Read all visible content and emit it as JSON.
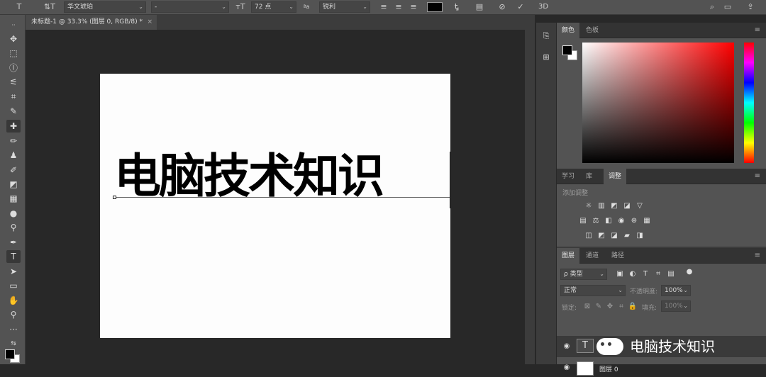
{
  "optbar": {
    "font_family": "华文琥珀",
    "font_style": "-",
    "font_size": "72 点",
    "aa_label": "ªa",
    "antialias": "锐利",
    "three_d": "3D"
  },
  "document": {
    "tab_title": "未标题-1 @ 33.3% (图层 0, RGB/8) *",
    "canvas_text": "电脑技术知识"
  },
  "color_panel": {
    "tabs": [
      "颜色",
      "色板"
    ],
    "foreground": "#000000",
    "background": "#ffffff",
    "hue_marker": "#ff0000"
  },
  "adjust_panel": {
    "tabs": [
      "学习",
      "库",
      "调整"
    ],
    "hint": "添加调整"
  },
  "layers_panel": {
    "tabs": [
      "图层",
      "通道",
      "路径"
    ],
    "kind_filter": "ρ 类型",
    "blend_mode": "正常",
    "opacity_label": "不透明度:",
    "opacity_value": "100%",
    "lock_label": "锁定:",
    "fill_label": "填充:",
    "fill_value": "100%",
    "layers": [
      {
        "name": "电脑技术知识",
        "type": "text"
      },
      {
        "name": "图层 0",
        "type": "pixel"
      }
    ]
  },
  "accent": "#3d7dd6"
}
